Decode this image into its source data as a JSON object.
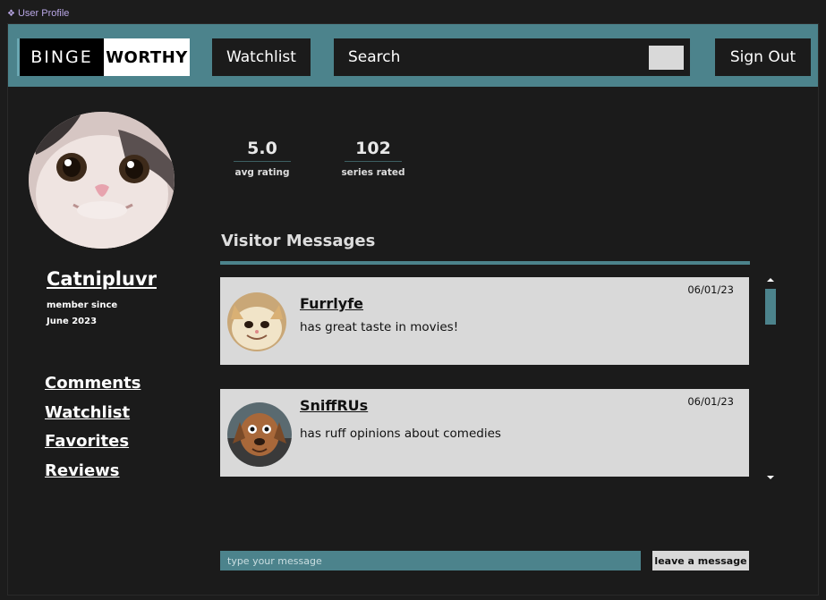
{
  "window": {
    "title": "User Profile"
  },
  "header": {
    "logo_left": "BINGE",
    "logo_right": "WORTHY",
    "watchlist_label": "Watchlist",
    "search_placeholder": "Search",
    "signout_label": "Sign Out"
  },
  "profile": {
    "username": "Catnipluvr",
    "member_since_label": "member since",
    "member_since_date": "June 2023"
  },
  "nav": {
    "items": [
      {
        "label": "Comments"
      },
      {
        "label": "Watchlist"
      },
      {
        "label": "Favorites"
      },
      {
        "label": "Reviews"
      }
    ]
  },
  "stats": [
    {
      "value": "5.0",
      "label": "avg rating"
    },
    {
      "value": "102",
      "label": "series rated"
    }
  ],
  "visitor_messages": {
    "title": "Visitor Messages",
    "messages": [
      {
        "author": "Furrlyfe",
        "text": "has great taste in movies!",
        "date": "06/01/23"
      },
      {
        "author": "SniffRUs",
        "text": "has ruff opinions about comedies",
        "date": "06/01/23"
      }
    ],
    "input_placeholder": "type your message",
    "submit_label": "leave a message"
  },
  "colors": {
    "accent": "#4c838c",
    "background": "#1b1b1b",
    "card": "#d9d9d9"
  }
}
